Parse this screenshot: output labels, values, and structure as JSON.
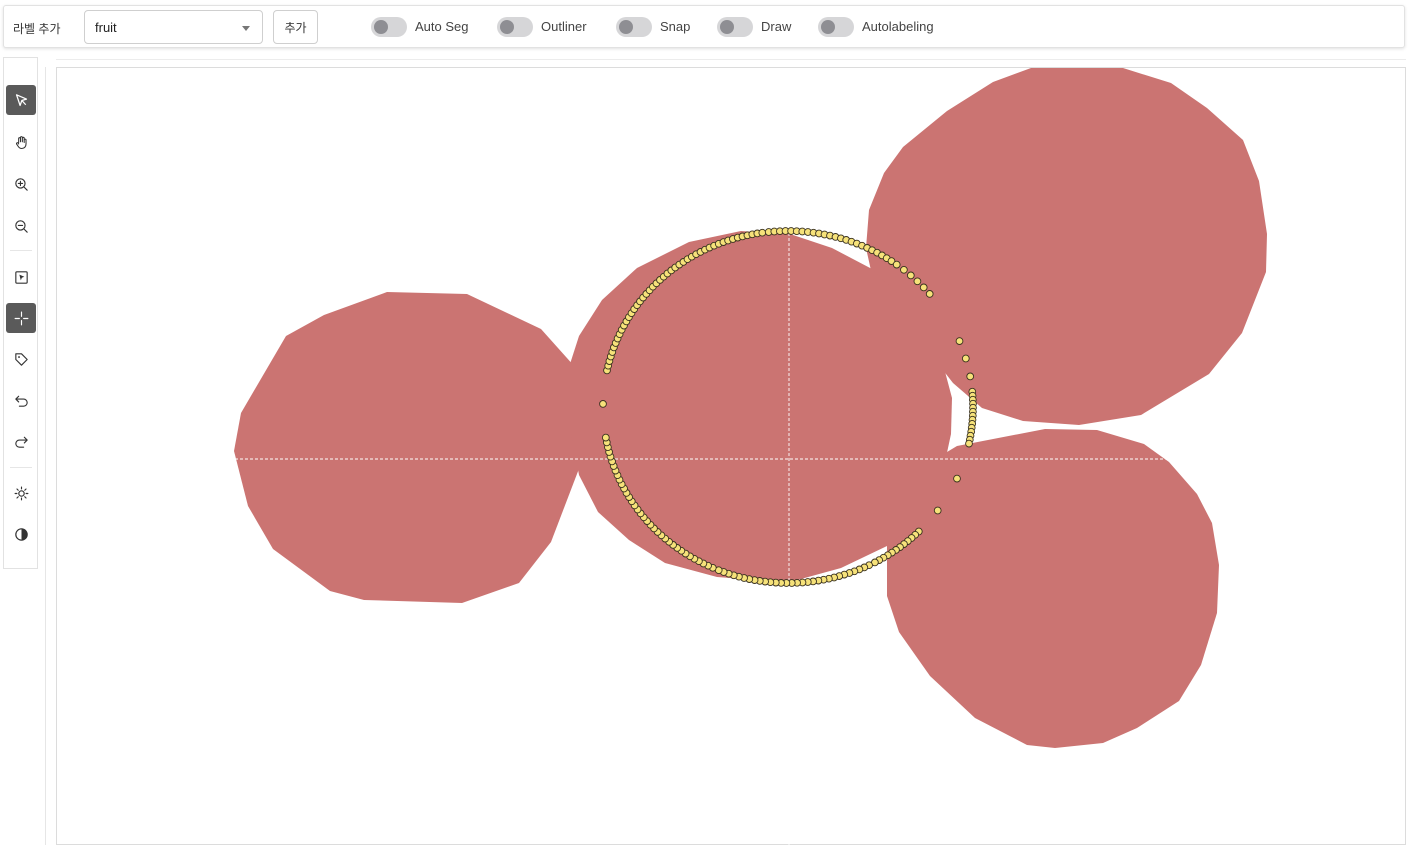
{
  "toolbar": {
    "label_caption": "라벨 추가",
    "label_select_value": "fruit",
    "add_button_label": "추가",
    "toggles": [
      {
        "label": "Auto Seg",
        "on": false
      },
      {
        "label": "Outliner",
        "on": false
      },
      {
        "label": "Snap",
        "on": false
      },
      {
        "label": "Draw",
        "on": false
      },
      {
        "label": "Autolabeling",
        "on": false
      }
    ]
  },
  "tools": [
    {
      "name": "select-pointer-icon",
      "active": true
    },
    {
      "name": "pan-hand-icon",
      "active": false
    },
    {
      "name": "zoom-in-icon",
      "active": false
    },
    {
      "name": "zoom-out-icon",
      "active": false
    },
    {
      "name": "select-box-icon",
      "active": false
    },
    {
      "name": "crosshair-icon",
      "active": true
    },
    {
      "name": "tag-icon",
      "active": false
    },
    {
      "name": "undo-icon",
      "active": false
    },
    {
      "name": "redo-icon",
      "active": false
    },
    {
      "name": "brightness-icon",
      "active": false
    },
    {
      "name": "contrast-icon",
      "active": false
    }
  ],
  "colors": {
    "polygon_fill": "#cb7472",
    "vertex_fill": "#f6e27a",
    "vertex_stroke": "#3b3320",
    "active_tool": "#5a5a5a"
  },
  "annotations": {
    "label": "fruit",
    "polygon_count": 4,
    "selected_polygon": "center"
  }
}
